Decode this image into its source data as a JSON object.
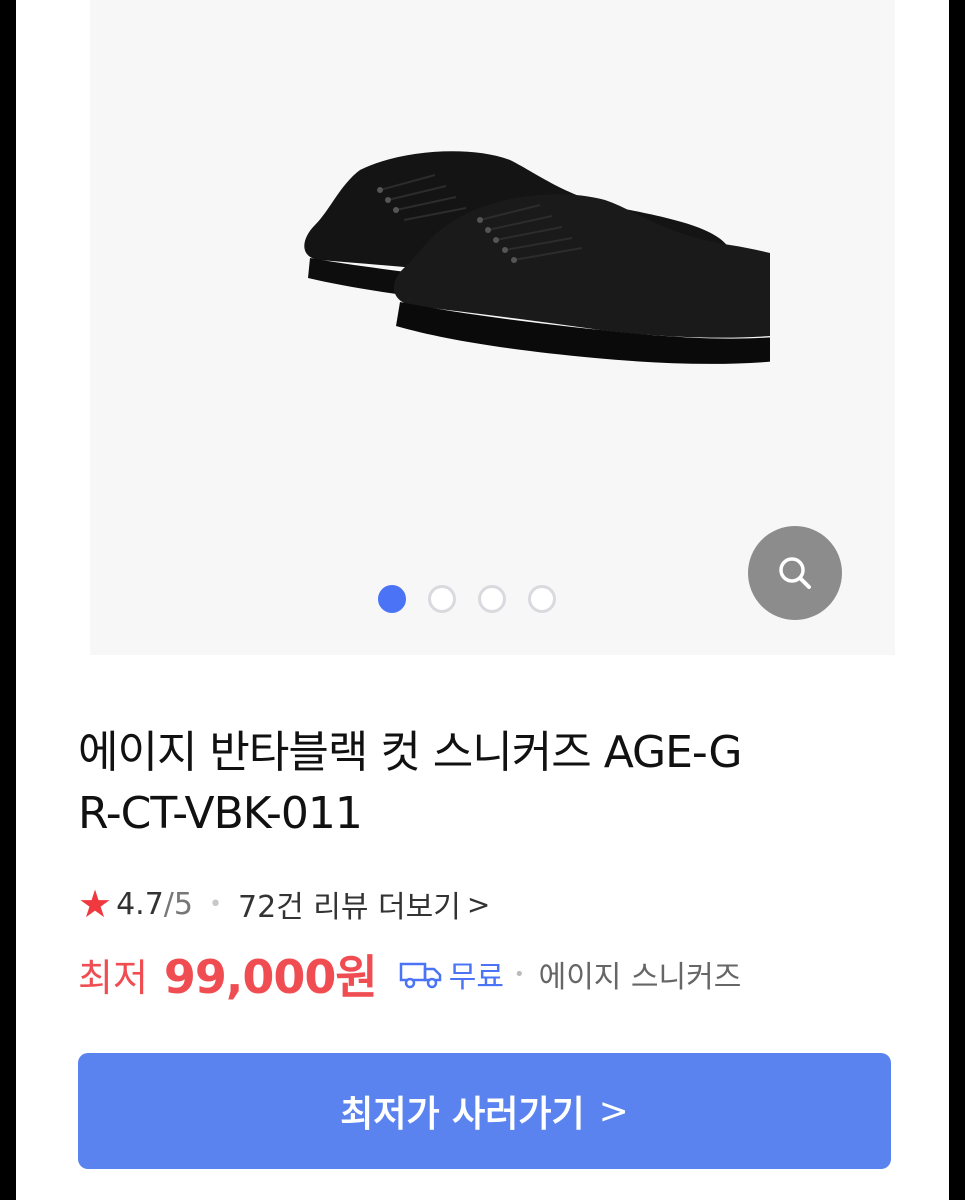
{
  "gallery": {
    "image_alt": "black low-top sneakers",
    "slides": 4,
    "active_slide": 1,
    "zoom_icon": "search-icon"
  },
  "product": {
    "title_line1": "에이지 반타블랙 컷 스니커즈 AGE-G",
    "title_line2": "R-CT-VBK-011"
  },
  "rating": {
    "star_icon": "star-icon",
    "value": "4.7",
    "max": "/5",
    "separator": "•",
    "reviews_label": "72건 리뷰 더보기",
    "chevron": ">"
  },
  "price": {
    "label": "최저",
    "value": "99,000원",
    "shipping_icon": "truck-icon",
    "shipping_label": "무료",
    "separator": "•",
    "seller": "에이지 스니커즈"
  },
  "cta": {
    "label": "최저가 사러가기",
    "chevron": ">"
  },
  "colors": {
    "accent_blue": "#4a74f5",
    "button_blue": "#5a83f0",
    "price_red": "#f04d52",
    "star_red": "#f0393f"
  }
}
